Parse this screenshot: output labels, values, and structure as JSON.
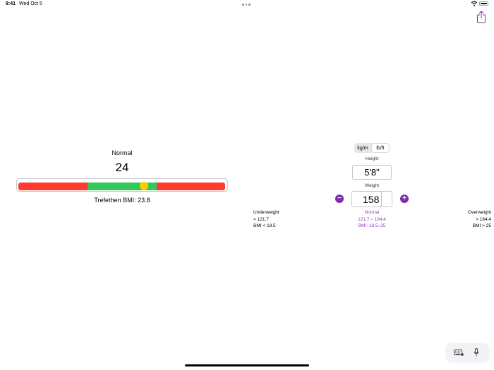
{
  "status_bar": {
    "time": "9:41",
    "date": "Wed Oct 5"
  },
  "result": {
    "category": "Normal",
    "bmi": "24",
    "bmi_fraction": 0.608,
    "trefethen": "Trefethen BMI: 23.8"
  },
  "units": {
    "options": [
      "kg/m",
      "lb/ft"
    ],
    "selected": "lb/ft"
  },
  "height": {
    "label": "Height",
    "value": "5'8\""
  },
  "weight": {
    "label": "Weight",
    "value": "158"
  },
  "ranges": {
    "underweight": {
      "title": "Underweight",
      "weight": "< 121.7",
      "bmi": "BMI < 18.5"
    },
    "normal": {
      "title": "Normal",
      "weight": "121.7 – 164.4",
      "bmi": "BMI: 18.5–25"
    },
    "overweight": {
      "title": "Overweight",
      "weight": "> 164.4",
      "bmi": "BMI > 25"
    }
  },
  "colors": {
    "underweight": "#ff3b30",
    "normal": "#34c759",
    "overweight": "#ff3b30",
    "marker": "#ffcc00",
    "accent": "#7b2fa8"
  },
  "icons": {
    "share": "share-icon",
    "minus": "minus-circle-icon",
    "plus": "plus-circle-icon",
    "keyboard": "keyboard-icon",
    "mic": "microphone-icon"
  }
}
